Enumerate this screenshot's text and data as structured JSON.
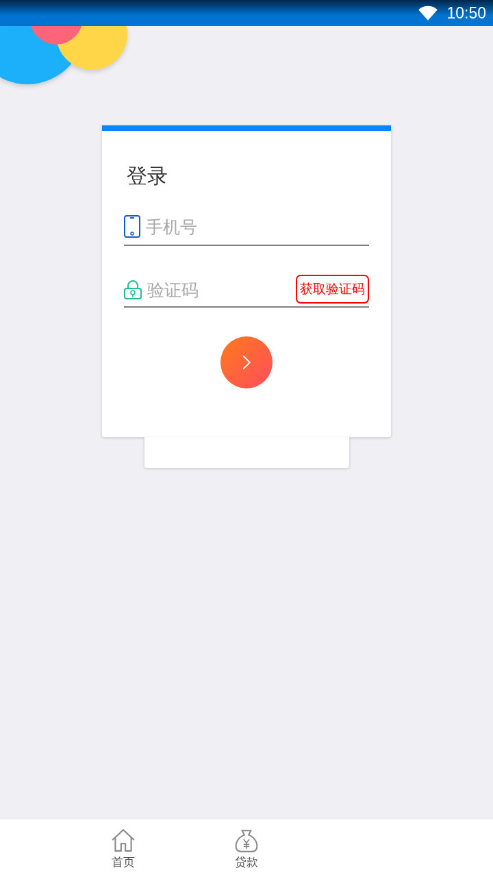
{
  "status_bar": {
    "time": "10:50"
  },
  "login_card": {
    "title": "登录",
    "phone_field": {
      "placeholder": "手机号"
    },
    "code_field": {
      "placeholder": "验证码"
    },
    "get_code_button": "获取验证码"
  },
  "tab_bar": [
    {
      "label": "首页",
      "kind": "home",
      "selected": false
    },
    {
      "label": "贷款",
      "kind": "loan",
      "selected": false
    }
  ]
}
